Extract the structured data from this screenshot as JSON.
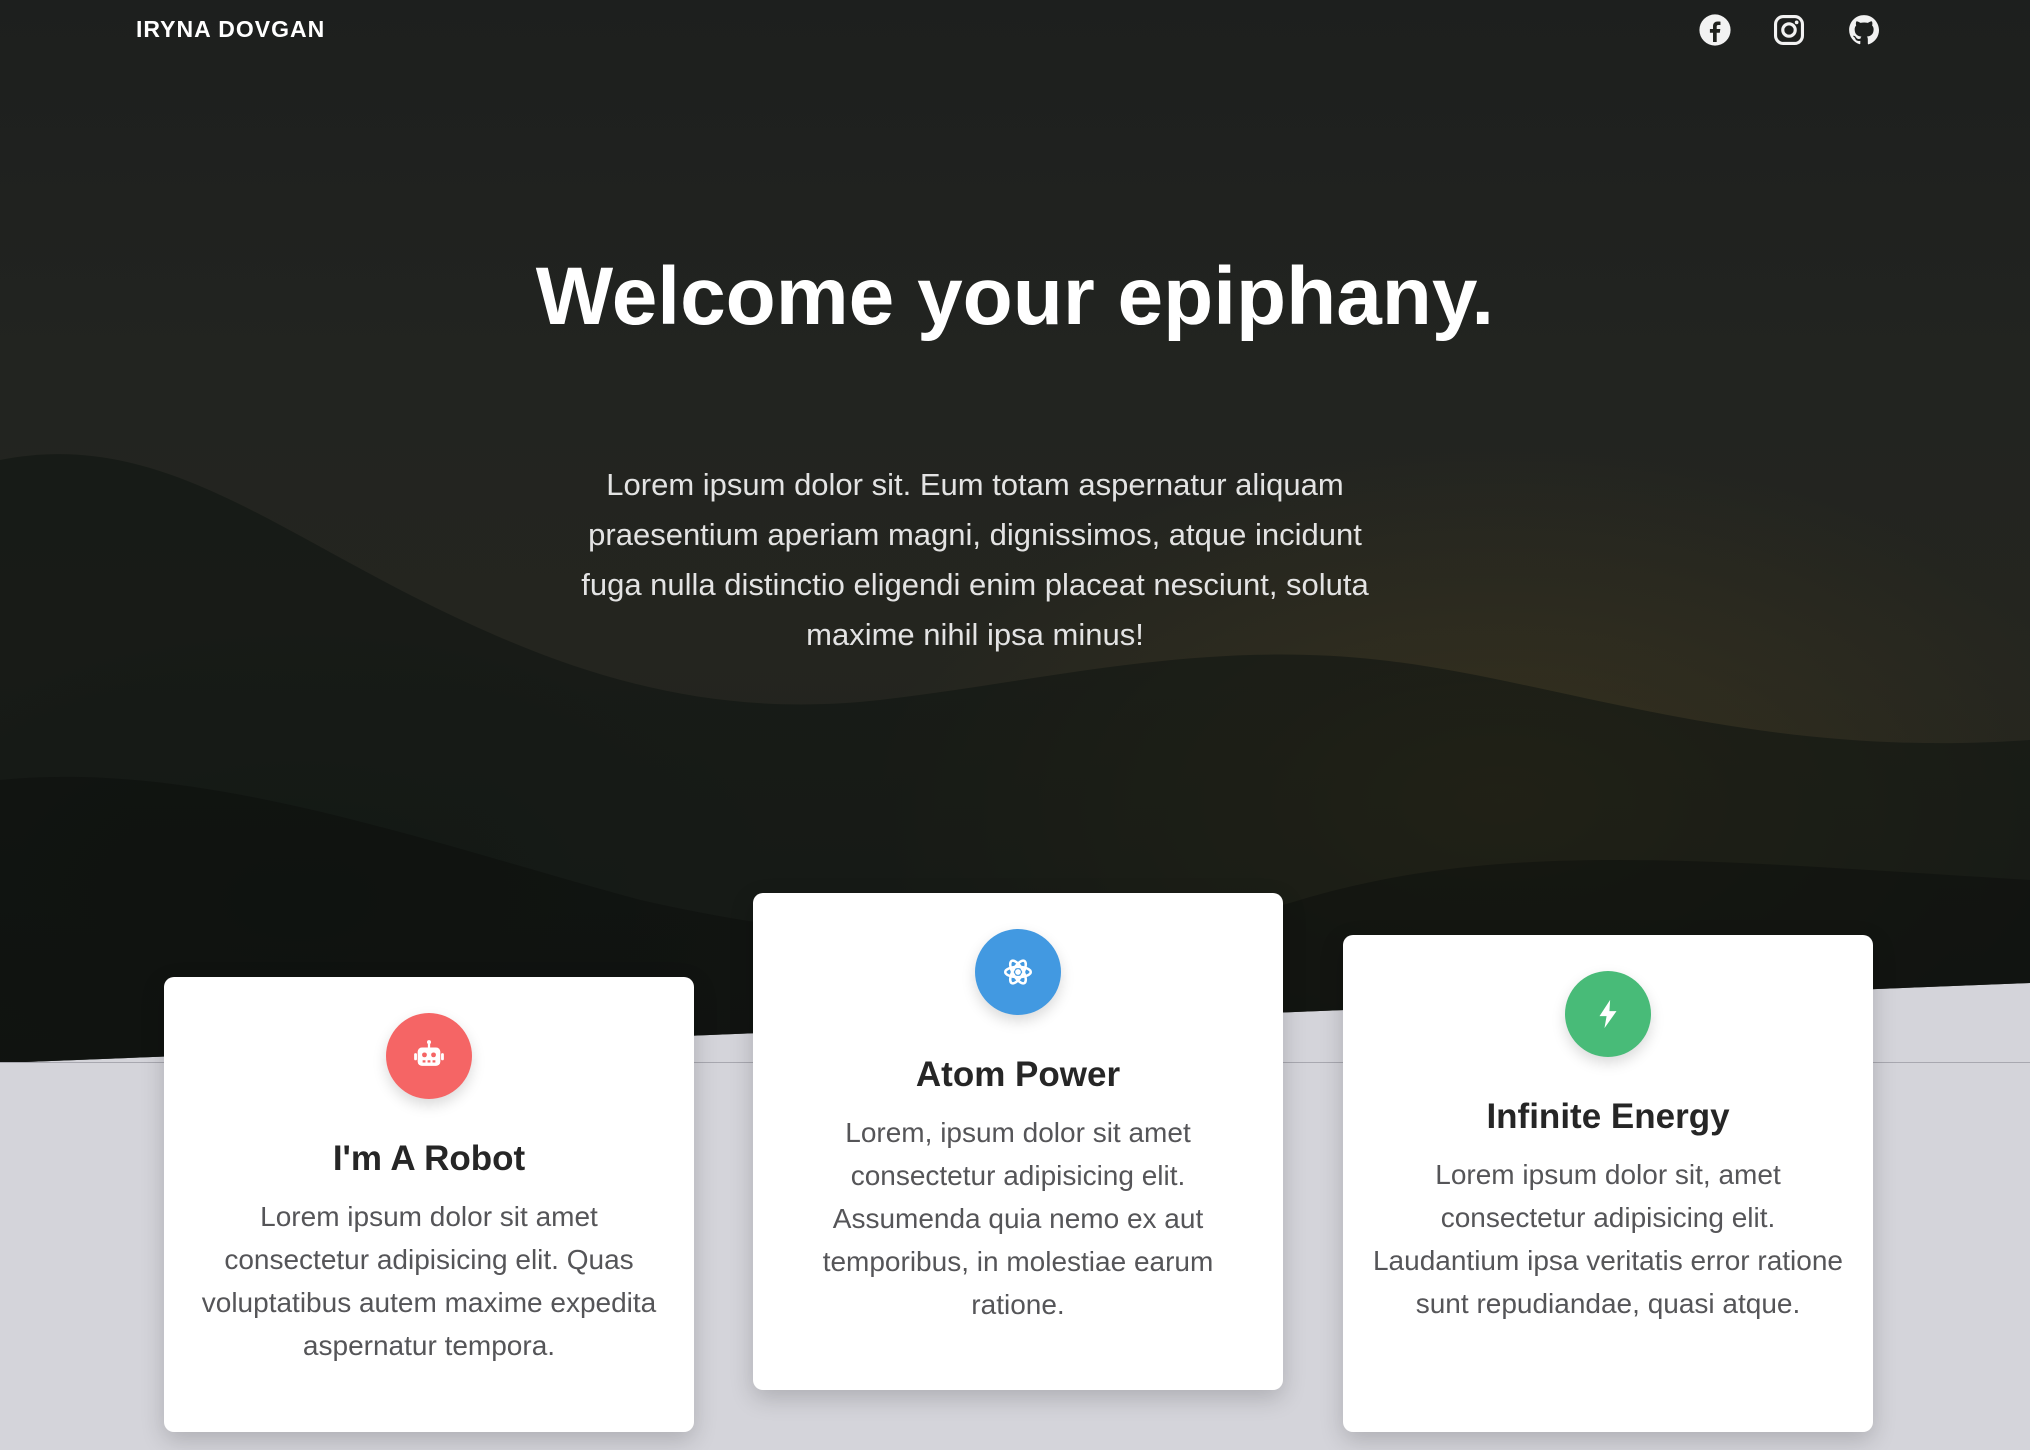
{
  "navbar": {
    "brand": "IRYNA DOVGAN",
    "social": [
      {
        "name": "facebook-icon"
      },
      {
        "name": "instagram-icon"
      },
      {
        "name": "github-icon"
      }
    ]
  },
  "hero": {
    "title": "Welcome your epiphany.",
    "subtitle": "Lorem ipsum dolor sit. Eum totam aspernatur aliquam praesentium aperiam magni, dignissimos, atque incidunt fuga nulla distinctio eligendi enim placeat nesciunt, soluta maxime nihil ipsa minus!"
  },
  "cards": [
    {
      "icon": "robot-icon",
      "icon_color": "#f56565",
      "title": "I'm A Robot",
      "text": "Lorem ipsum dolor sit amet consectetur adipisicing elit. Quas voluptatibus autem maxime expedita aspernatur tempora."
    },
    {
      "icon": "atom-icon",
      "icon_color": "#4299e1",
      "title": "Atom Power",
      "text": "Lorem, ipsum dolor sit amet consectetur adipisicing elit. Assumenda quia nemo ex aut temporibus, in molestiae earum ratione."
    },
    {
      "icon": "bolt-icon",
      "icon_color": "#48bb78",
      "title": "Infinite Energy",
      "text": "Lorem ipsum dolor sit, amet consectetur adipisicing elit. Laudantium ipsa veritatis error ratione sunt repudiandae, quasi atque."
    }
  ],
  "colors": {
    "hero_overlay": "#1f211d",
    "section_bg": "#d4d4da",
    "card_bg": "#ffffff"
  }
}
